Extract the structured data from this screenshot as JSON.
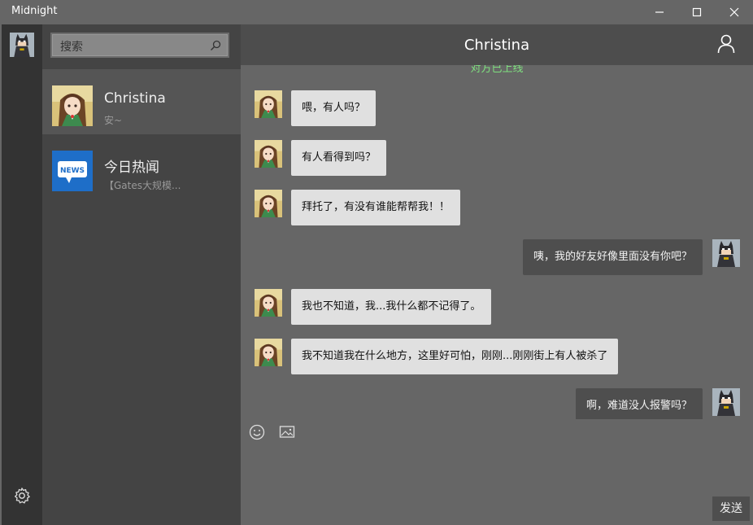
{
  "window": {
    "title": "Midnight"
  },
  "search": {
    "placeholder": "搜索"
  },
  "conversations": [
    {
      "name": "Christina",
      "preview": "安~"
    },
    {
      "name": "今日热闻",
      "preview": "【Gates大规模...",
      "icon_label": "NEWS"
    }
  ],
  "chat": {
    "title": "Christina",
    "status": "对方已上线",
    "messages": [
      {
        "from": "them",
        "text": "喂，有人吗？"
      },
      {
        "from": "them",
        "text": "有人看得到吗？"
      },
      {
        "from": "them",
        "text": "拜托了，有没有谁能帮帮我！！"
      },
      {
        "from": "me",
        "text": "咦，我的好友好像里面没有你吧？"
      },
      {
        "from": "them",
        "text": "我也不知道，我...我什么都不记得了。"
      },
      {
        "from": "them",
        "text": "我不知道我在什么地方，这里好可怕，刚刚...刚刚街上有人被杀了"
      },
      {
        "from": "me",
        "text": "啊，难道没人报警吗？"
      }
    ]
  },
  "composer": {
    "send_label": "发送"
  },
  "icons": {
    "minimize": "minimize-icon",
    "maximize": "maximize-icon",
    "close": "close-icon",
    "search": "search-icon",
    "settings": "gear-icon",
    "profile": "person-icon",
    "emoji": "emoji-icon",
    "image": "image-icon"
  },
  "colors": {
    "status_online": "#7fe07f",
    "news_blue": "#1e6ec8"
  }
}
